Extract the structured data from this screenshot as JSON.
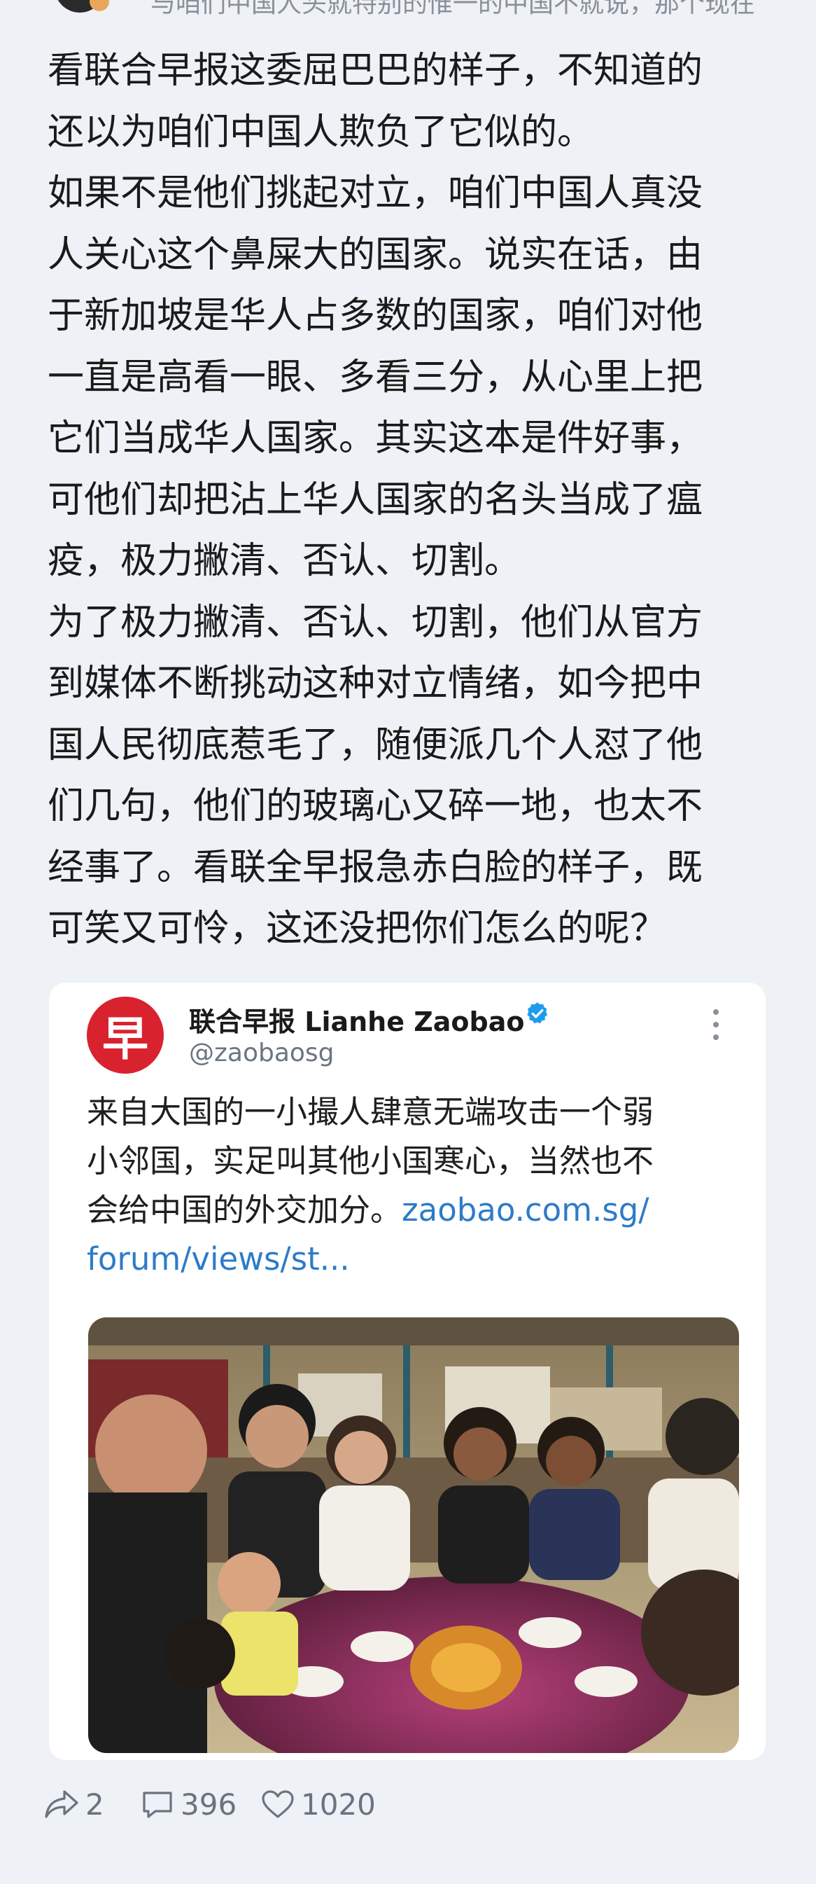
{
  "top_fragment": "与咱们中国人头就特别的惟一的中国不就说，那个现在",
  "post": {
    "paragraphs": [
      "看联合早报这委屈巴巴的样子，不知道的\n还以为咱们中国人欺负了它似的。",
      "如果不是他们挑起对立，咱们中国人真没\n人关心这个鼻屎大的国家。说实在话，由\n于新加坡是华人占多数的国家，咱们对他\n一直是高看一眼、多看三分，从心里上把\n它们当成华人国家。其实这本是件好事，\n可他们却把沾上华人国家的名头当成了瘟\n疫，极力撇清、否认、切割。",
      "为了极力撇清、否认、切割，他们从官方\n到媒体不断挑动这种对立情绪，如今把中\n国人民彻底惹毛了，随便派几个人怼了他\n们几句，他们的玻璃心又碎一地，也太不\n经事了。看联全早报急赤白脸的样子，既\n可笑又可怜，这还没把你们怎么的呢？"
    ]
  },
  "tweet": {
    "avatar_char": "早",
    "name": "联合早报 Lianhe Zaobao",
    "handle": "@zaobaosg",
    "text": "来自大国的一小撮人肆意无端攻击一个弱\n小邻国，实足叫其他小国寒心，当然也不\n会给中国的外交加分。",
    "link": "zaobao.com.sg/\nforum/views/st...",
    "verified_color": "#1d9bf0",
    "logo_color": "#d8232f"
  },
  "actions": {
    "share_count": "2",
    "comment_count": "396",
    "like_count": "1020"
  }
}
